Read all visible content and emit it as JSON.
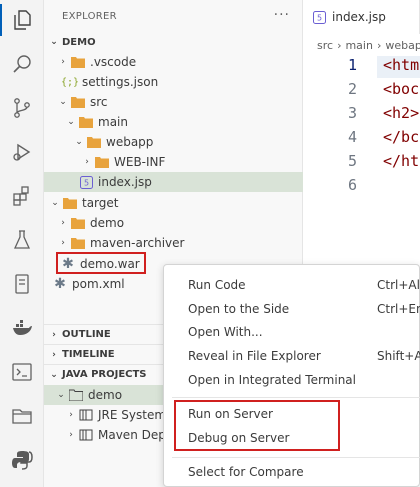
{
  "activity_bar": {
    "icons": [
      "files-icon",
      "search-icon",
      "source-control-icon",
      "run-debug-icon",
      "extensions-icon",
      "testing-icon",
      "notebook-icon",
      "docker-icon",
      "terminal-icon",
      "folder-icon",
      "python-icon"
    ]
  },
  "explorer": {
    "title": "EXPLORER",
    "more": "···",
    "root": "DEMO",
    "tree": [
      {
        "label": ".vscode",
        "kind": "folder"
      },
      {
        "label": "settings.json",
        "kind": "json"
      },
      {
        "label": "src",
        "kind": "folder"
      },
      {
        "label": "main",
        "kind": "folder"
      },
      {
        "label": "webapp",
        "kind": "folder"
      },
      {
        "label": "WEB-INF",
        "kind": "folder"
      },
      {
        "label": "index.jsp",
        "kind": "jsp"
      },
      {
        "label": "target",
        "kind": "folder"
      },
      {
        "label": "demo",
        "kind": "folder"
      },
      {
        "label": "maven-archiver",
        "kind": "folder"
      },
      {
        "label": "demo.war",
        "kind": "war"
      },
      {
        "label": "pom.xml",
        "kind": "war"
      }
    ],
    "sections": {
      "outline": "OUTLINE",
      "timeline": "TIMELINE",
      "java_projects": "JAVA PROJECTS"
    },
    "java_tree": [
      {
        "label": "demo"
      },
      {
        "label": "JRE System L"
      },
      {
        "label": "Maven Depe"
      }
    ]
  },
  "editor": {
    "tab_label": "index.jsp",
    "breadcrumb": [
      "src",
      "main",
      "webap"
    ],
    "line_numbers": [
      "1",
      "2",
      "3",
      "4",
      "5",
      "6"
    ],
    "lines": [
      "<htm",
      "<boc",
      "<h2>",
      "</bc",
      "</ht",
      ""
    ]
  },
  "context_menu": {
    "items": [
      {
        "label": "Run Code",
        "shortcut": "Ctrl+Alt"
      },
      {
        "label": "Open to the Side",
        "shortcut": "Ctrl+Ent"
      },
      {
        "label": "Open With...",
        "shortcut": ""
      },
      {
        "label": "Reveal in File Explorer",
        "shortcut": "Shift+Alt"
      },
      {
        "label": "Open in Integrated Terminal",
        "shortcut": ""
      },
      {
        "label": "Run on Server",
        "shortcut": ""
      },
      {
        "label": "Debug on Server",
        "shortcut": ""
      },
      {
        "label": "Select for Compare",
        "shortcut": ""
      }
    ]
  },
  "colors": {
    "highlight_box": "#d0201f",
    "folder": "#e8a33d",
    "jsp_icon": "#6b5fd3",
    "json_icon": "#8aa52a",
    "selected_row": "#d9e3d7"
  }
}
